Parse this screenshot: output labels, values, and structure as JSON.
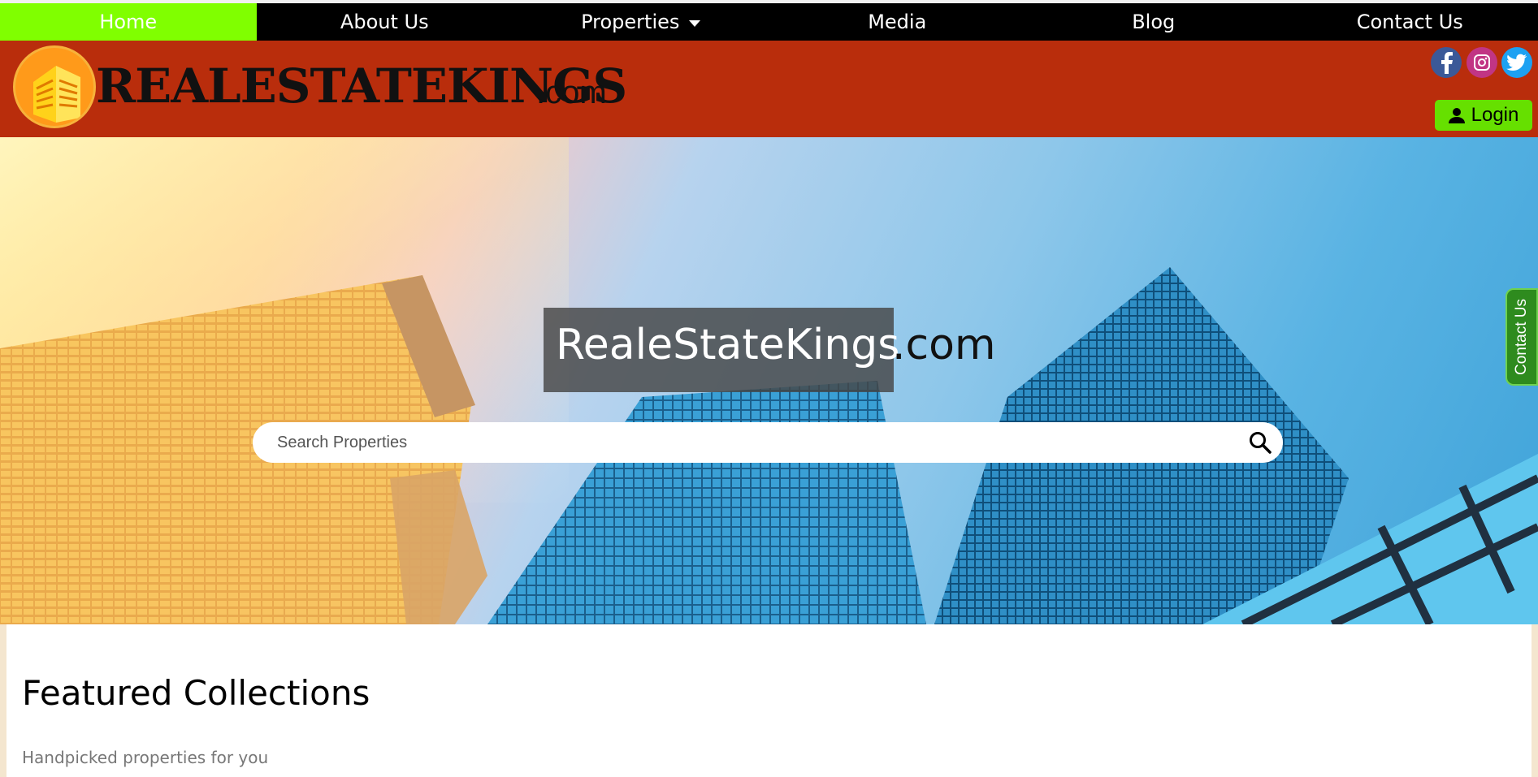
{
  "nav": {
    "items": [
      {
        "label": "Home",
        "active": true
      },
      {
        "label": "About Us"
      },
      {
        "label": "Properties",
        "has_dropdown": true
      },
      {
        "label": "Media"
      },
      {
        "label": "Blog"
      },
      {
        "label": "Contact Us"
      }
    ]
  },
  "header": {
    "logo_text": "REALESTATEKINGS",
    "logo_suffix": ".com",
    "social_icons": [
      "facebook-icon",
      "instagram-icon",
      "twitter-icon"
    ],
    "login_label": "Login"
  },
  "hero": {
    "title": "RealeStateKings",
    "title_suffix": ".com",
    "search": {
      "placeholder": "Search Properties",
      "value": ""
    }
  },
  "contact_tab": {
    "label": "Contact Us"
  },
  "featured": {
    "title": "Featured Collections",
    "subtitle": "Handpicked properties for you"
  },
  "colors": {
    "nav_active": "#80ff00",
    "header_bg": "#b92d0c",
    "login_bg": "#66e000",
    "contact_tab_bg": "#2e8b1e"
  }
}
